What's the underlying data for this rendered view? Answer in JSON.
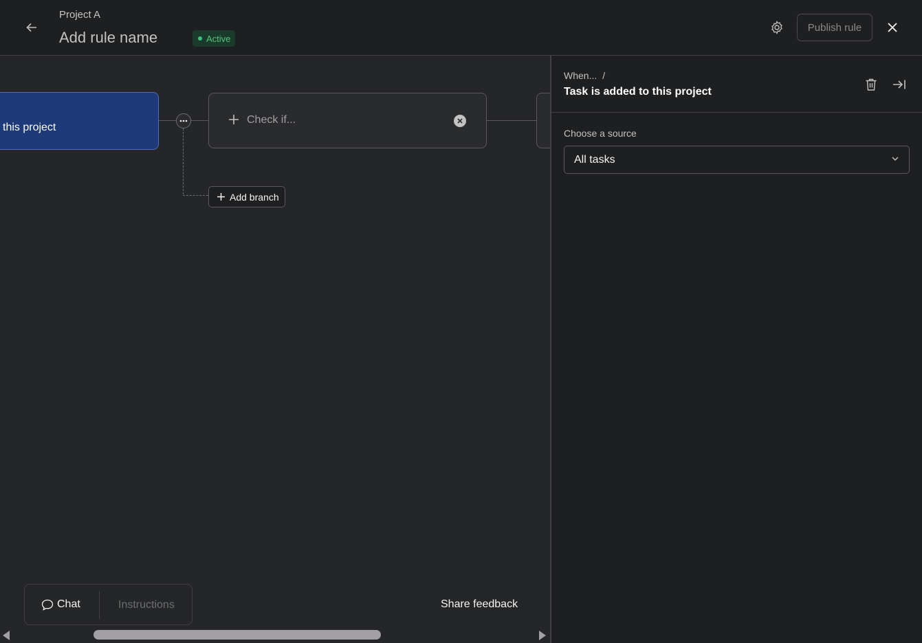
{
  "header": {
    "project_name": "Project A",
    "rule_name": "Add rule name",
    "status_badge": "Active",
    "publish_label": "Publish rule"
  },
  "canvas": {
    "trigger_text": "this project",
    "check_label": "Check if...",
    "add_branch_label": "Add branch",
    "chat_label": "Chat",
    "instructions_label": "Instructions",
    "share_feedback_label": "Share feedback"
  },
  "panel": {
    "breadcrumb": "When...",
    "breadcrumb_sep": "/",
    "title": "Task is added to this project",
    "source_label": "Choose a source",
    "source_value": "All tasks"
  },
  "colors": {
    "background": "#252628",
    "topbar": "#1e1f21",
    "trigger_card": "#1f3a78",
    "trigger_border": "#4f6fc4",
    "badge_text": "#58c27d"
  },
  "icons": [
    "arrow-left-icon",
    "gear-icon",
    "close-icon",
    "ellipsis-icon",
    "plus-icon",
    "x-circle-icon",
    "chat-bubble-icon",
    "trash-icon",
    "collapse-right-icon",
    "chevron-down-icon"
  ]
}
